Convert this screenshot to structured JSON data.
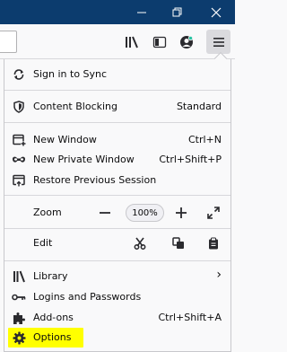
{
  "menu": {
    "sign_in": "Sign in to Sync",
    "content_blocking": "Content Blocking",
    "content_blocking_state": "Standard",
    "new_window": "New Window",
    "new_window_sc": "Ctrl+N",
    "new_private": "New Private Window",
    "new_private_sc": "Ctrl+Shift+P",
    "restore": "Restore Previous Session",
    "zoom_label": "Zoom",
    "zoom_minus": "—",
    "zoom_value": "100%",
    "zoom_plus": "+",
    "edit_label": "Edit",
    "library": "Library",
    "library_arrow": "›",
    "logins": "Logins and Passwords",
    "addons": "Add-ons",
    "addons_sc": "Ctrl+Shift+A",
    "options": "Options"
  },
  "colors": {
    "titlebar": "#0c3c6e",
    "highlight": "#ffff00"
  }
}
